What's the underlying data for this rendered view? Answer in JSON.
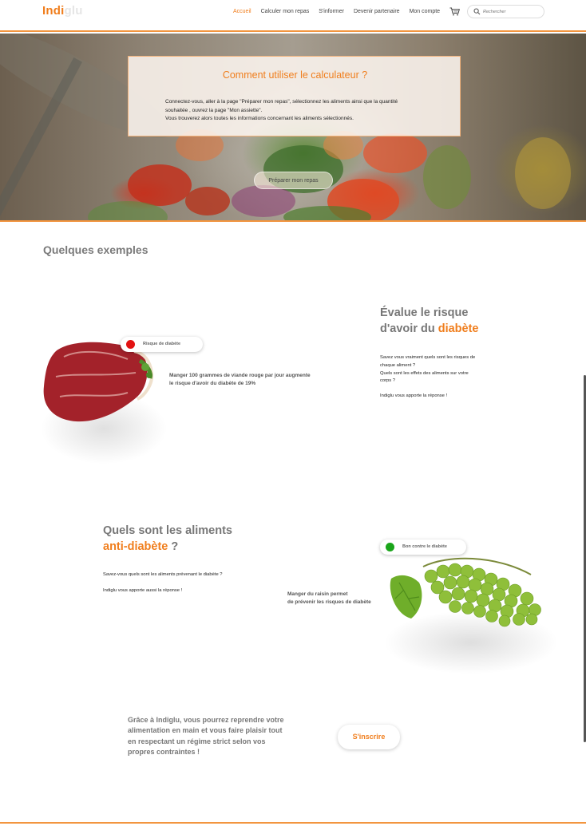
{
  "header": {
    "logo_part1": "Indi",
    "logo_part2": "glu",
    "nav": [
      "Accueil",
      "Calculer mon repas",
      "S'informer",
      "Devenir partenaire",
      "Mon compte"
    ],
    "search_placeholder": "Rechercher",
    "accent_color": "#f07e1d"
  },
  "hero": {
    "title": "Comment utiliser le calculateur ?",
    "text_line1": "Connectez-vous, aller à la page \"Préparer mon repas\", sélectionnez les aliments ainsi que la quantité",
    "text_line2": "souhaitée , ouvrez la page \"Mon assiette\".",
    "text_line3": "Vous trouverez alors toutes les informations concernant les aliments sélectionnés.",
    "button": "Préparer mon repas"
  },
  "examples": {
    "title": "Quelques exemples",
    "meat": {
      "badge": "Risque de diabète",
      "badge_color": "#e31212",
      "caption_line1": "Manger 100 grammes de viande rouge par jour augmente",
      "caption_line2": "le risque d'avoir du diabète de 19%"
    },
    "risk": {
      "title_line1": "Évalue le risque",
      "title_line2_a": "d'avoir du ",
      "title_line2_b": "diabète",
      "p1": "Savez vous vraiment quels sont les risques de",
      "p2": "chaque aliment ?",
      "p3": "Quels sont les effets des aliments sur votre",
      "p4": "corps ?",
      "p5": "Indiglu vous apporte la réponse !"
    },
    "anti": {
      "title_line1": "Quels sont les aliments",
      "title_line2_a": "anti-diabète",
      "title_line2_b": " ?",
      "p1": "Savez-vous quels sont les aliments prévenant le diabète ?",
      "p2": "Indiglu vous apporte aussi la réponse !"
    },
    "grapes": {
      "badge": "Bon contre le diabète",
      "badge_color": "#1aa51a",
      "caption_line1": "Manger du raisin permet",
      "caption_line2": "de prévenir les risques de diabète"
    }
  },
  "cta": {
    "line1": "Grâce à Indiglu, vous pourrez reprendre votre",
    "line2": "alimentation en main et vous faire plaisir tout",
    "line3": "en respectant un régime strict selon vos",
    "line4": "propres contraintes !",
    "button": "S'inscrire"
  }
}
